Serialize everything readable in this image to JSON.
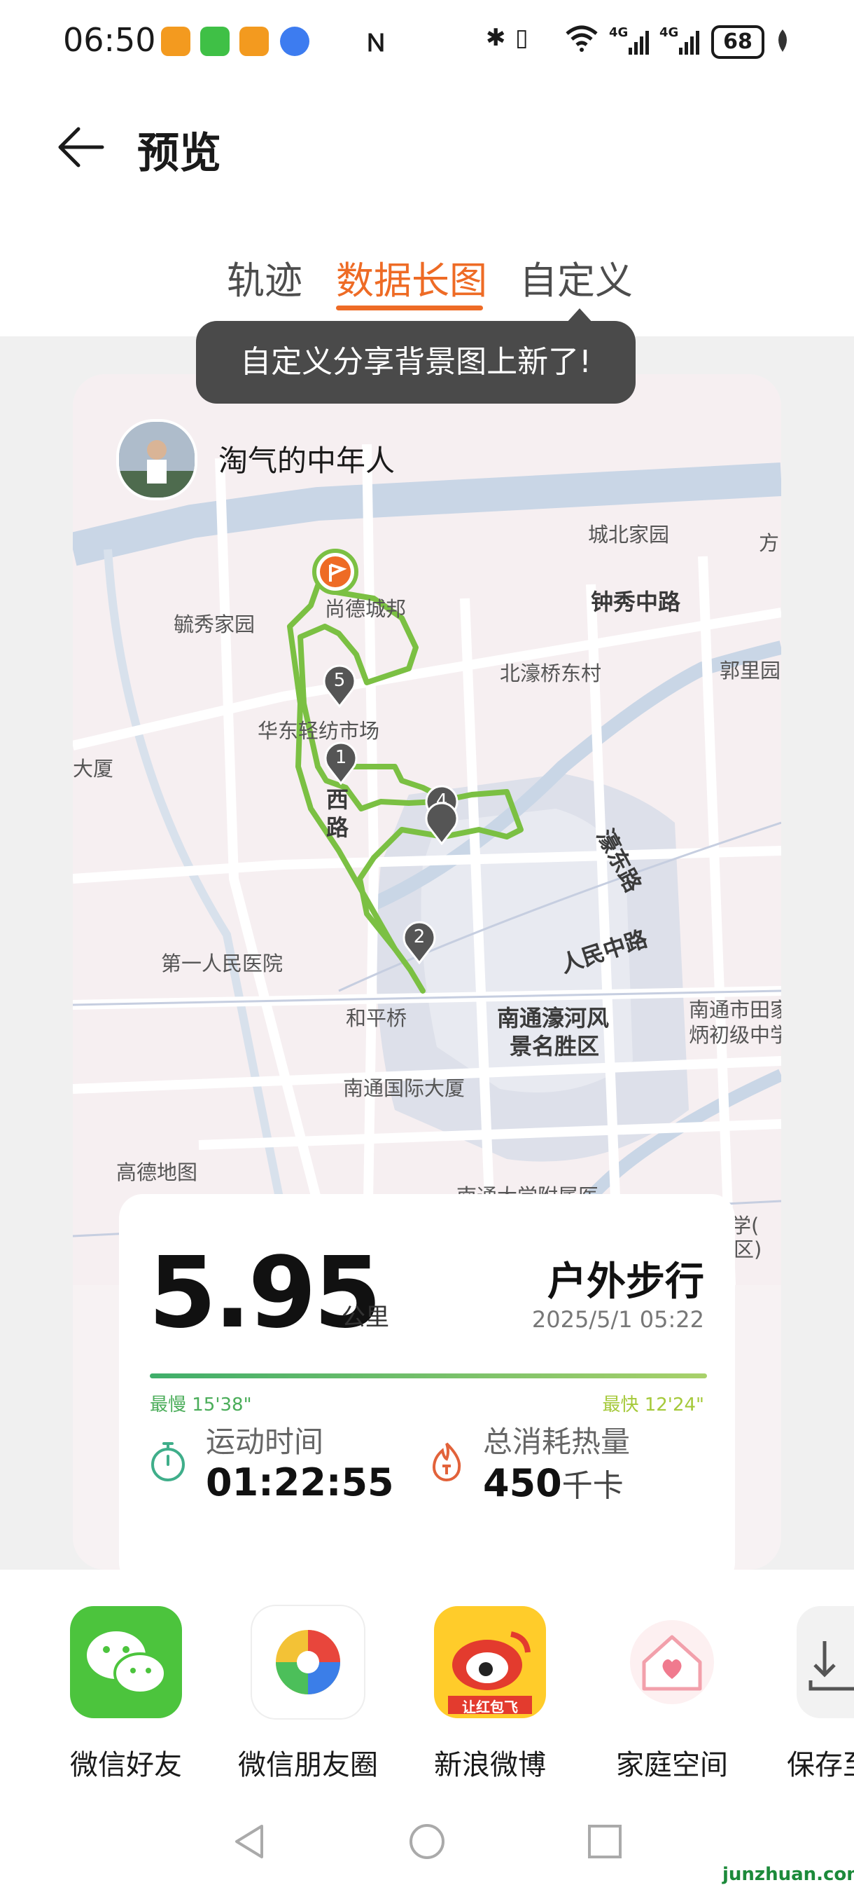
{
  "status_bar": {
    "time": "06:50",
    "battery": "68",
    "net1": "4G",
    "net2": "4G"
  },
  "header": {
    "title": "预览"
  },
  "tabs": [
    {
      "label": "轨迹",
      "active": false
    },
    {
      "label": "数据长图",
      "active": true
    },
    {
      "label": "自定义",
      "active": false
    }
  ],
  "tooltip": "自定义分享背景图上新了!",
  "card": {
    "username": "淘气的中年人",
    "map_labels": {
      "chengbei": "城北家园",
      "fang": "方",
      "zhongxiu": "钟秀中路",
      "yuxiu": "毓秀家园",
      "shangde": "尚德城邦",
      "haoqiao": "北濠桥东村",
      "guoli": "郭里园",
      "huadong": "华东轻纺市场",
      "dasha": "大厦",
      "xilu_1": "西",
      "xilu_2": "路",
      "haodong": "濠东路",
      "renmin": "人民中路",
      "yiyuan": "第一人民医院",
      "hepingqiao": "和平桥",
      "haohe_1": "南通濠河风",
      "haohe_2": "景名胜区",
      "tianjia_1": "南通市田家",
      "tianjia_2": "炳初级中学",
      "guoji": "南通国际大厦",
      "gaode": "高德地图",
      "fuyuan": "南通大学附属医",
      "xue": "学(",
      "qu": "区)"
    },
    "markers": [
      "1",
      "2",
      "4",
      "5"
    ],
    "distance": "5.95",
    "distance_unit": "公里",
    "activity_type": "户外步行",
    "datetime": "2025/5/1 05:22",
    "pace_slow": "最慢 15'38\"",
    "pace_fast": "最快 12'24\"",
    "stats": [
      {
        "label": "运动时间",
        "value": "01:22:55",
        "unit": ""
      },
      {
        "label": "总消耗热量",
        "value": "450",
        "unit": "千卡"
      }
    ]
  },
  "share": [
    {
      "label": "微信好友",
      "icon": "wechat-icon",
      "color": "#4cc43d"
    },
    {
      "label": "微信朋友圈",
      "icon": "moments-icon",
      "color": "#ffffff"
    },
    {
      "label": "新浪微博",
      "icon": "weibo-icon",
      "color": "#ffcc2a"
    },
    {
      "label": "家庭空间",
      "icon": "home-space-icon",
      "color": "#ffffff"
    },
    {
      "label": "保存至",
      "icon": "save-icon",
      "color": "#f2f2f2"
    }
  ],
  "weibo_badge": "让红包飞",
  "watermark": "junzhuan.com"
}
